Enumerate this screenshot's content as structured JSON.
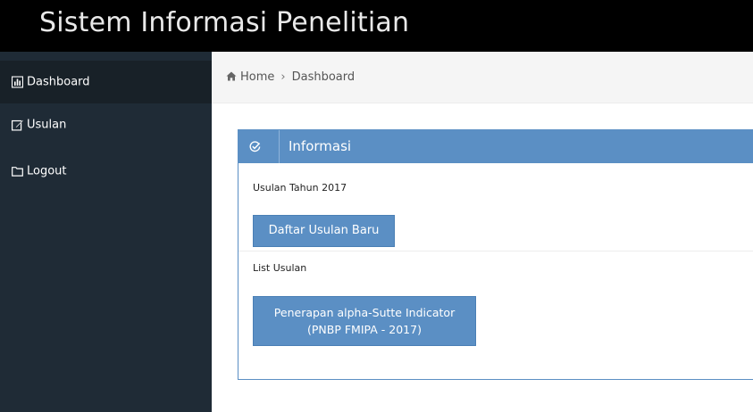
{
  "app": {
    "title": "Sistem Informasi Penelitian"
  },
  "sidebar": {
    "items": [
      {
        "label": "Dashboard",
        "icon": "bar-chart-icon",
        "active": true
      },
      {
        "label": "Usulan",
        "icon": "edit-icon",
        "active": false
      },
      {
        "label": "Logout",
        "icon": "folder-icon",
        "active": false
      }
    ]
  },
  "breadcrumb": {
    "home": "Home",
    "separator": "›",
    "current": "Dashboard"
  },
  "panel": {
    "title": "Informasi",
    "year_text": "Usulan Tahun 2017",
    "new_button_label": "Daftar Usulan Baru",
    "list_label": "List Usulan",
    "proposal": {
      "line1": "Penerapan alpha-Sutte Indicator",
      "line2": "(PNBP FMIPA - 2017)"
    }
  },
  "colors": {
    "topbar": "#000000",
    "sidebar": "#1f2b36",
    "accent": "#5b8fc4",
    "breadcrumb_bg": "#f5f5f5"
  }
}
